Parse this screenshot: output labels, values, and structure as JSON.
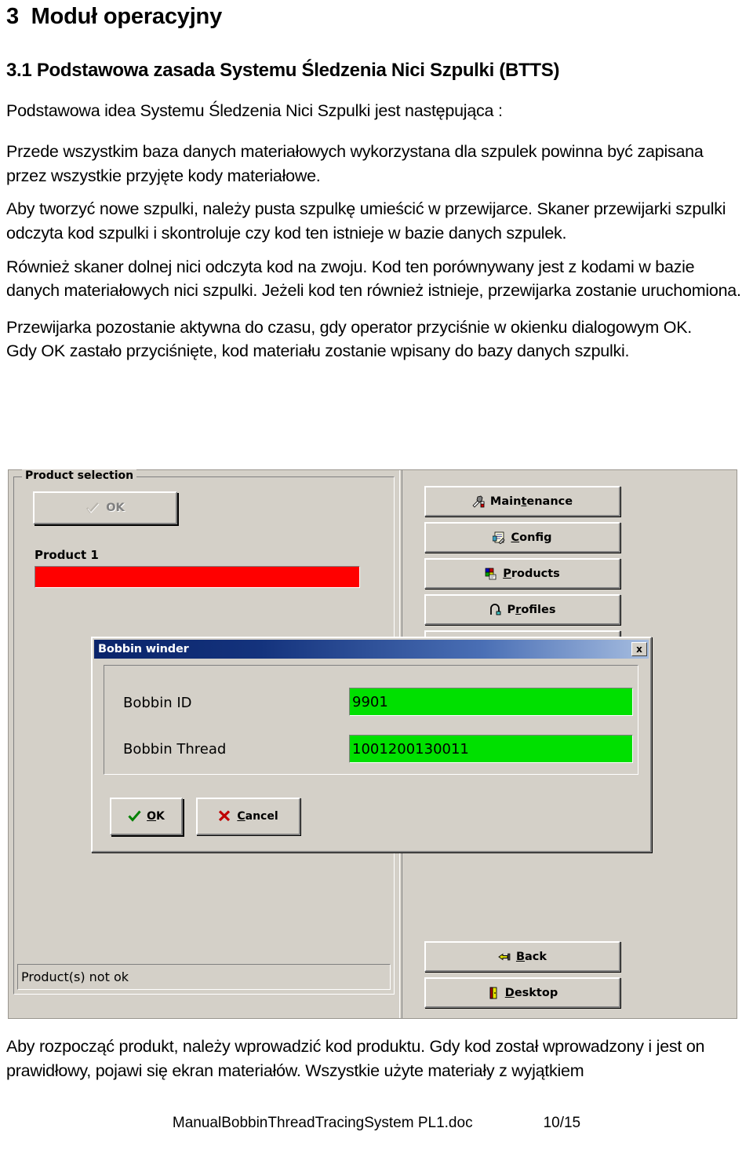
{
  "document": {
    "heading_number": "3",
    "heading_title": "Moduł operacyjny",
    "subheading": "3.1  Podstawowa zasada Systemu Śledzenia Nici Szpulki (BTTS)",
    "paragraphs": [
      "Podstawowa idea Systemu Śledzenia Nici Szpulki jest następująca :",
      "Przede wszystkim baza danych materiałowych wykorzystana dla szpulek powinna być zapisana przez wszystkie przyjęte kody materiałowe.",
      "Aby tworzyć nowe szpulki, należy pusta szpulkę umieścić w przewijarce. Skaner przewijarki szpulki odczyta kod szpulki i skontroluje czy kod ten istnieje w bazie danych szpulek.",
      "Również skaner dolnej nici odczyta kod na zwoju. Kod ten porównywany jest z kodami w bazie danych materiałowych nici szpulki. Jeżeli kod ten również istnieje, przewijarka zostanie uruchomiona.",
      "Przewijarka pozostanie aktywna do czasu, gdy operator przyciśnie w okienku dialogowym OK.",
      "Gdy OK zastało przyciśnięte, kod materiału zostanie wpisany do bazy danych szpulki."
    ],
    "after_figure": "Aby rozpocząć produkt, należy wprowadzić kod produktu. Gdy kod został wprowadzony i jest on prawidłowy, pojawi się ekran materiałów. Wszystkie użyte materiały z wyjątkiem",
    "footer_file": "ManualBobbinThreadTracingSystem PL1.doc",
    "footer_page": "10/15"
  },
  "screenshot": {
    "product_selection": {
      "group_title": "Product selection",
      "ok_button": {
        "label": "OK",
        "icon": "check-icon",
        "state": "disabled"
      },
      "product_label": "Product 1",
      "product_bar_color": "#ff0000",
      "status_text": "Product(s) not ok"
    },
    "side_buttons": [
      {
        "label": "Maintenance",
        "icon": "maintenance-icon",
        "accesskey": "t"
      },
      {
        "label": "Config",
        "icon": "config-icon",
        "accesskey": "C"
      },
      {
        "label": "Products",
        "icon": "products-icon",
        "accesskey": "P"
      },
      {
        "label": "Profiles",
        "icon": "profiles-icon",
        "accesskey": "r"
      }
    ],
    "bottom_buttons": [
      {
        "label": "Back",
        "icon": "back-arrow-icon",
        "accesskey": "B"
      },
      {
        "label": "Desktop",
        "icon": "desktop-door-icon",
        "accesskey": "D"
      }
    ],
    "dialog": {
      "title": "Bobbin winder",
      "close_label": "x",
      "fields": [
        {
          "label": "Bobbin ID",
          "value": "9901",
          "color": "#00e000"
        },
        {
          "label": "Bobbin Thread",
          "value": "1001200130011",
          "color": "#00e000"
        }
      ],
      "buttons": [
        {
          "label": "OK",
          "icon": "check-icon",
          "accesskey": "O",
          "default": true
        },
        {
          "label": "Cancel",
          "icon": "cross-icon",
          "accesskey": "C",
          "default": false
        }
      ]
    }
  }
}
